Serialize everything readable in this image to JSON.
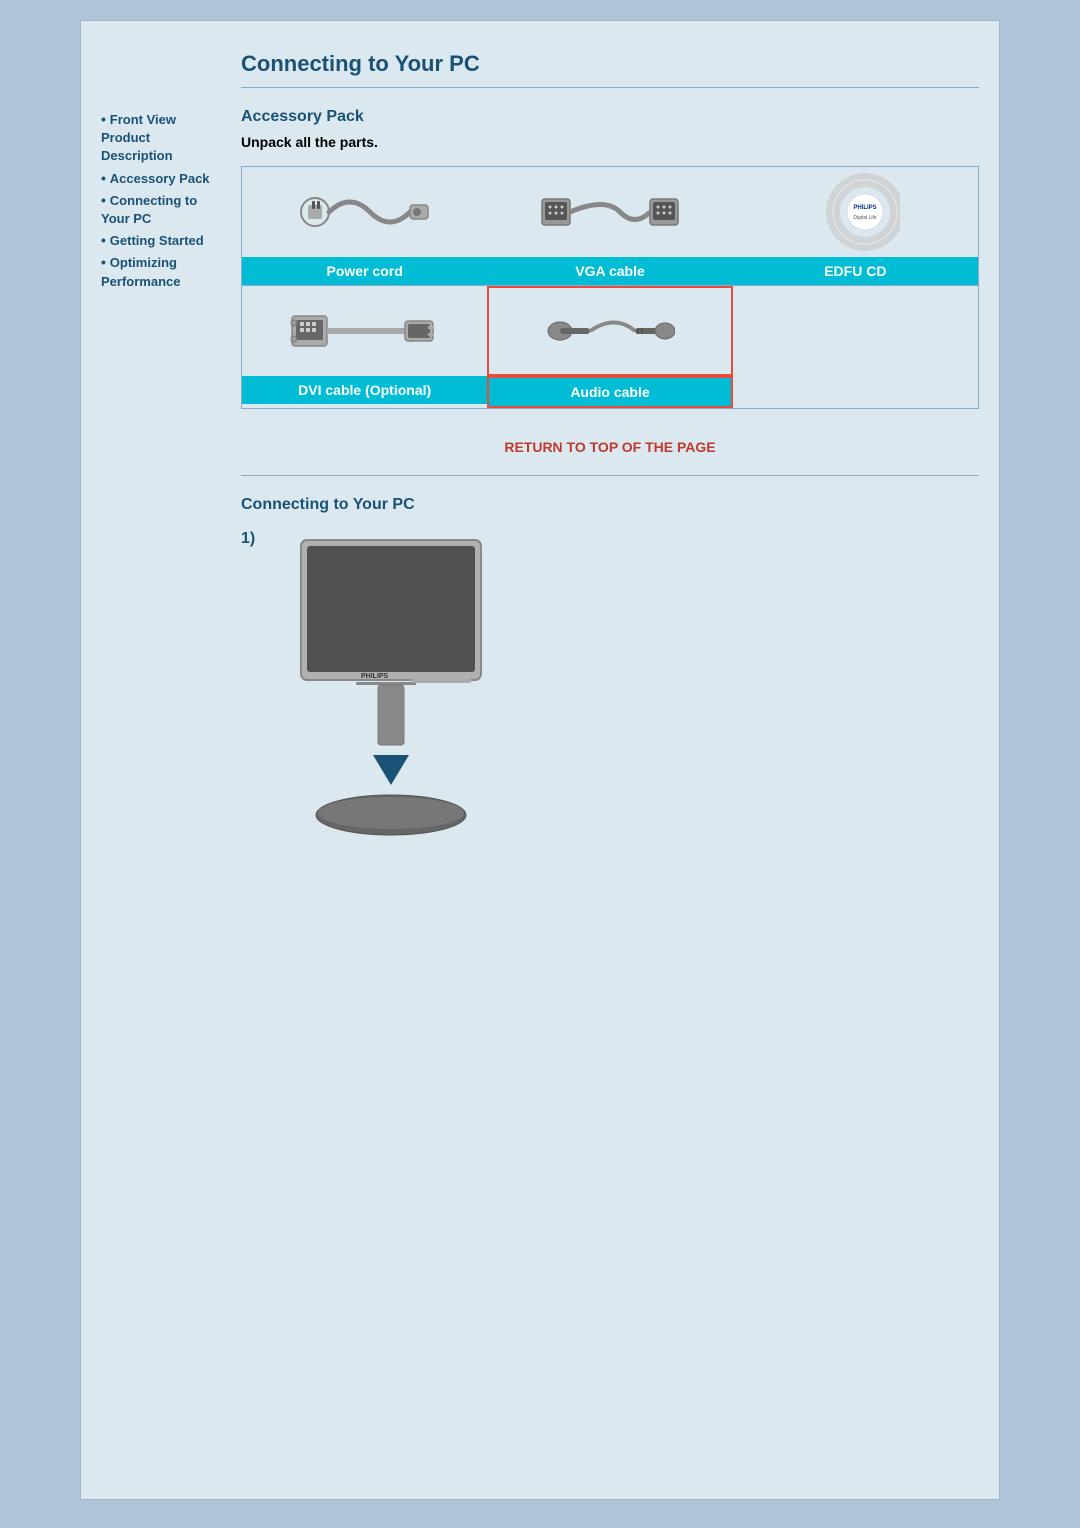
{
  "page": {
    "title": "Connecting to Your PC",
    "bg_color": "#dce8f0",
    "accent_color": "#1a5276"
  },
  "sidebar": {
    "items": [
      {
        "label": "Front View Product Description",
        "href": "#"
      },
      {
        "label": "Accessory Pack",
        "href": "#"
      },
      {
        "label": "Connecting to Your PC",
        "href": "#"
      },
      {
        "label": "Getting Started",
        "href": "#"
      },
      {
        "label": "Optimizing Performance",
        "href": "#"
      }
    ]
  },
  "accessory_section": {
    "title": "Accessory Pack",
    "subtitle": "Unpack all the parts.",
    "items_row1": [
      {
        "label": "Power cord",
        "highlighted": false
      },
      {
        "label": "VGA cable",
        "highlighted": false
      },
      {
        "label": "EDFU CD",
        "highlighted": false
      }
    ],
    "items_row2": [
      {
        "label": "DVI cable (Optional)",
        "highlighted": false
      },
      {
        "label": "Audio cable",
        "highlighted": true
      },
      {
        "label": "",
        "highlighted": false
      }
    ]
  },
  "return_link": {
    "label": "RETURN TO TOP OF THE PAGE"
  },
  "connecting_section": {
    "title": "Connecting to Your PC",
    "step1": "1)"
  }
}
